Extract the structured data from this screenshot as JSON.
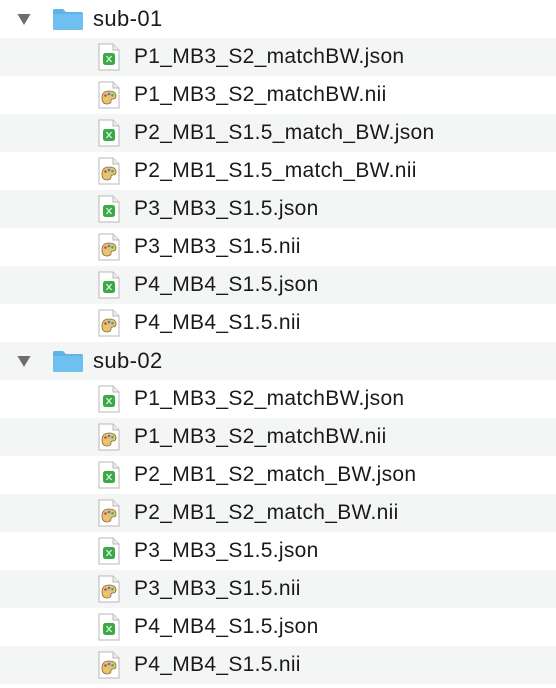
{
  "colors": {
    "row_stripe": "#f4f5f5",
    "folder_blue": "#6fc0f0",
    "json_green": "#3aa845",
    "text": "#1a1a1a"
  },
  "groups": [
    {
      "folder": "sub-01",
      "expanded": true,
      "files": [
        {
          "name": "P1_MB3_S2_matchBW.json",
          "icon": "json-file-icon"
        },
        {
          "name": "P1_MB3_S2_matchBW.nii",
          "icon": "nii-file-icon"
        },
        {
          "name": "P2_MB1_S1.5_match_BW.json",
          "icon": "json-file-icon"
        },
        {
          "name": "P2_MB1_S1.5_match_BW.nii",
          "icon": "nii-file-icon"
        },
        {
          "name": "P3_MB3_S1.5.json",
          "icon": "json-file-icon"
        },
        {
          "name": "P3_MB3_S1.5.nii",
          "icon": "nii-file-icon"
        },
        {
          "name": "P4_MB4_S1.5.json",
          "icon": "json-file-icon"
        },
        {
          "name": "P4_MB4_S1.5.nii",
          "icon": "nii-file-icon"
        }
      ]
    },
    {
      "folder": "sub-02",
      "expanded": true,
      "files": [
        {
          "name": "P1_MB3_S2_matchBW.json",
          "icon": "json-file-icon"
        },
        {
          "name": "P1_MB3_S2_matchBW.nii",
          "icon": "nii-file-icon"
        },
        {
          "name": "P2_MB1_S2_match_BW.json",
          "icon": "json-file-icon"
        },
        {
          "name": "P2_MB1_S2_match_BW.nii",
          "icon": "nii-file-icon"
        },
        {
          "name": "P3_MB3_S1.5.json",
          "icon": "json-file-icon"
        },
        {
          "name": "P3_MB3_S1.5.nii",
          "icon": "nii-file-icon"
        },
        {
          "name": "P4_MB4_S1.5.json",
          "icon": "json-file-icon"
        },
        {
          "name": "P4_MB4_S1.5.nii",
          "icon": "nii-file-icon"
        }
      ]
    }
  ]
}
